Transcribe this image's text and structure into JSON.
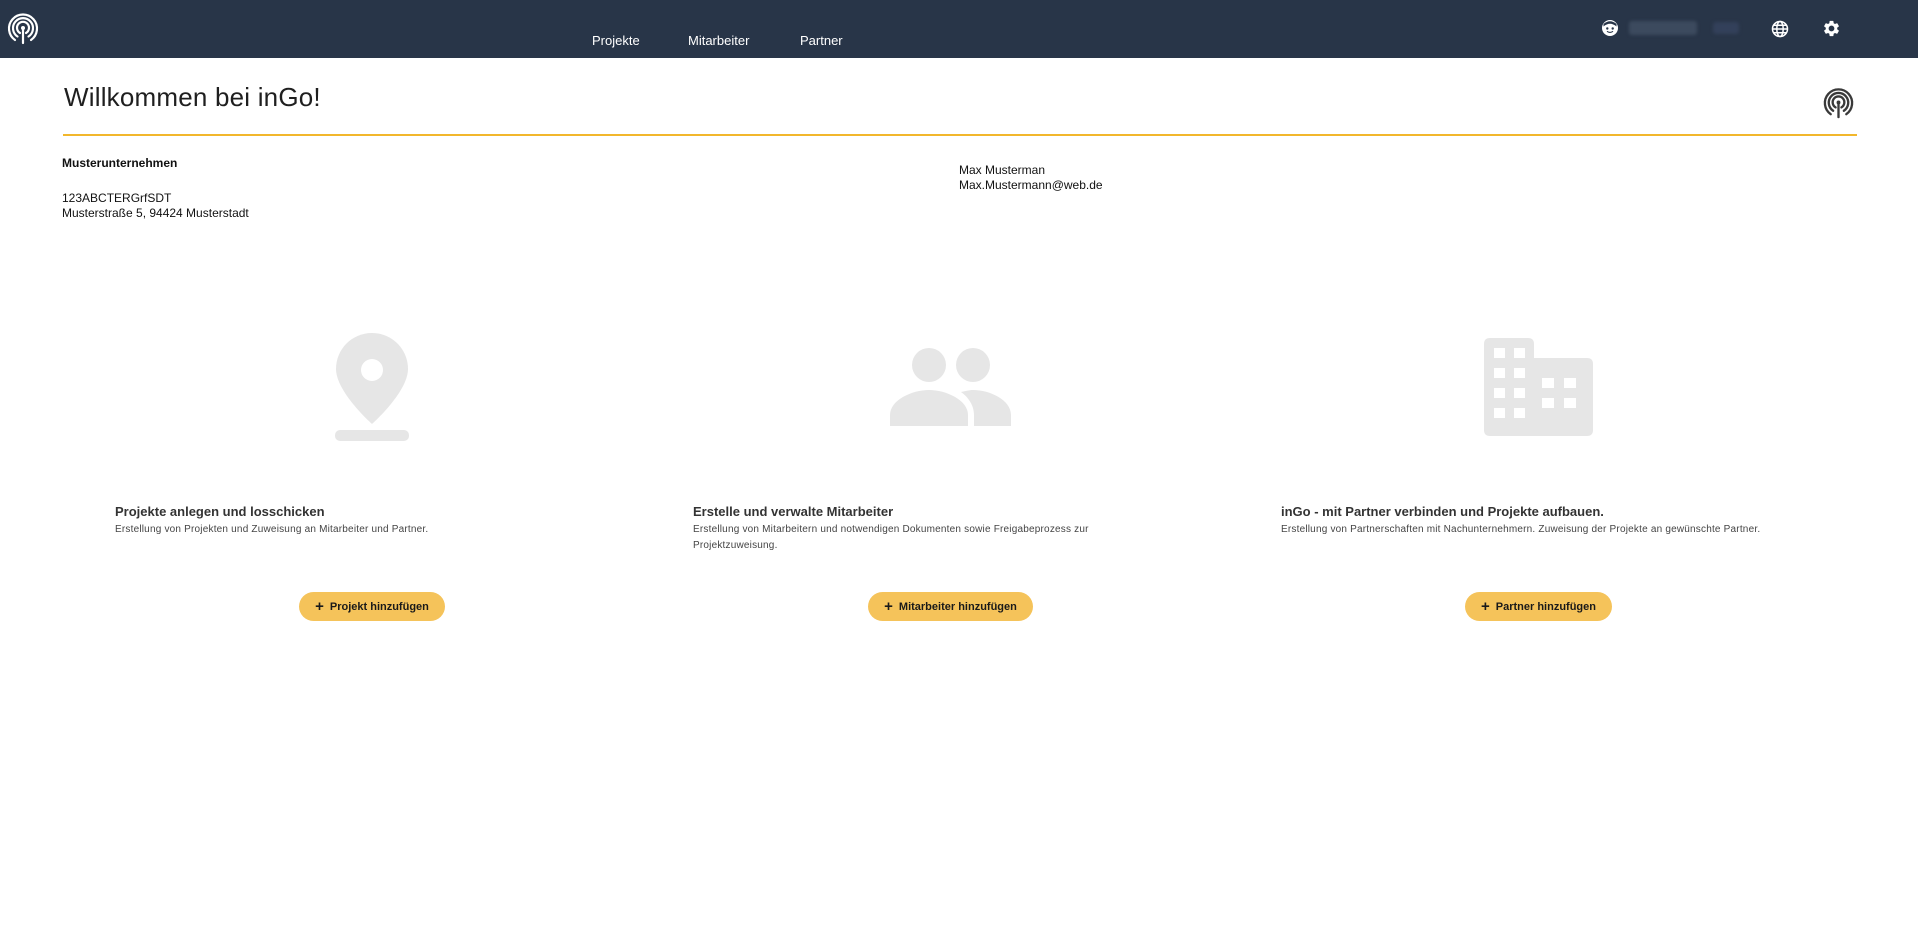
{
  "nav": {
    "items": [
      {
        "label": "Projekte"
      },
      {
        "label": "Mitarbeiter"
      },
      {
        "label": "Partner"
      }
    ]
  },
  "header": {
    "title": "Willkommen bei inGo!"
  },
  "company": {
    "name": "Musterunternehmen",
    "id": "123ABCTERGrfSDT",
    "address": "Musterstraße 5, 94424 Musterstadt"
  },
  "contact": {
    "name": "Max Musterman",
    "email": "Max.Mustermann@web.de"
  },
  "cards": [
    {
      "icon": "location-pin-icon",
      "title": "Projekte anlegen und losschicken",
      "description": "Erstellung von Projekten und Zuweisung an Mitarbeiter und Partner.",
      "button_label": "Projekt hinzufügen"
    },
    {
      "icon": "people-icon",
      "title": "Erstelle und verwalte Mitarbeiter",
      "description": "Erstellung von Mitarbeitern und notwendigen Dokumenten sowie Freigabeprozess zur Projektzuweisung.",
      "button_label": "Mitarbeiter hinzufügen"
    },
    {
      "icon": "building-icon",
      "title": "inGo - mit Partner verbinden und Projekte aufbauen.",
      "description": "Erstellung von Partnerschaften mit Nachunternehmern. Zuweisung der Projekte an gewünschte Partner.",
      "button_label": "Partner hinzufügen"
    }
  ],
  "colors": {
    "topbar": "#283548",
    "accent": "#f2b72c",
    "button": "#f5c35a",
    "icon_gray": "#e6e6e6"
  }
}
